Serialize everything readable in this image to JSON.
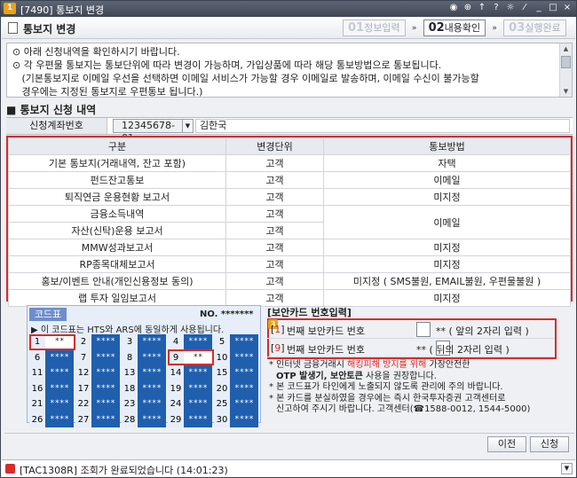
{
  "window": {
    "app_number": "1",
    "title": "[7490] 통보지 변경",
    "controls": [
      "◉",
      "⊕",
      "↑",
      "?",
      "☼",
      "⁄",
      "_",
      "□",
      "×"
    ]
  },
  "header": {
    "page_title": "통보지 변경",
    "steps": [
      {
        "num": "01",
        "label": "정보입력"
      },
      {
        "num": "02",
        "label": "내용확인"
      },
      {
        "num": "03",
        "label": "실행완료"
      }
    ],
    "arrow": "»"
  },
  "notice": {
    "lines": [
      "⊙ 아래 신청내역을 확인하시기 바랍니다.",
      "⊙ 각 우편물 통보지는 통보단위에 따라 변경이 가능하며, 가입상품에 따라 해당 통보방법으로 통보됩니다.",
      "   (기본통보지로 이메일 우선을 선택하면 이메일 서비스가 가능할 경우 이메일로 발송하며, 이메일 수신이 불가능할",
      "   경우에는 지정된 통보지로 우편통보 됩니다.)"
    ]
  },
  "section_title": "■  통보지 신청 내역",
  "account": {
    "label": "신청계좌번호",
    "number": "12345678-01",
    "name": "김한국"
  },
  "table": {
    "headers": [
      "구분",
      "변경단위",
      "통보방법"
    ],
    "rows": [
      [
        "기본 통보지(거래내역, 잔고 포함)",
        "고객",
        "자택"
      ],
      [
        "펀드잔고통보",
        "고객",
        "이메일"
      ],
      [
        "퇴직연금 운용현황 보고서",
        "고객",
        "미지정"
      ],
      [
        "금융소득내역",
        "고객",
        "이메일"
      ],
      [
        "자산(신탁)운용 보고서",
        "고객",
        ""
      ],
      [
        "MMW성과보고서",
        "고객",
        "미지정"
      ],
      [
        "RP종목대체보고서",
        "고객",
        "미지정"
      ],
      [
        "홍보/이벤트 안내(개인신용정보 동의)",
        "고객",
        "미지정 ( SMS불원, EMAIL불원, 우편물불원 )"
      ],
      [
        "랩 투자 일임보고서",
        "고객",
        "미지정"
      ]
    ]
  },
  "code_card": {
    "header": "코드표",
    "number_label": "NO. *******",
    "info": "▶ 이 코드표는 HTS와 ARS에 동일하게 사용됩니다.",
    "cells": [
      [
        "1",
        "**"
      ],
      [
        "2",
        "****"
      ],
      [
        "3",
        "****"
      ],
      [
        "4",
        "****"
      ],
      [
        "5",
        "****"
      ],
      [
        "6",
        "****"
      ],
      [
        "7",
        "****"
      ],
      [
        "8",
        "****"
      ],
      [
        "9",
        "**"
      ],
      [
        "10",
        "****"
      ],
      [
        "11",
        "****"
      ],
      [
        "12",
        "****"
      ],
      [
        "13",
        "****"
      ],
      [
        "14",
        "****"
      ],
      [
        "15",
        "****"
      ],
      [
        "16",
        "****"
      ],
      [
        "17",
        "****"
      ],
      [
        "18",
        "****"
      ],
      [
        "19",
        "****"
      ],
      [
        "20",
        "****"
      ],
      [
        "21",
        "****"
      ],
      [
        "22",
        "****"
      ],
      [
        "23",
        "****"
      ],
      [
        "24",
        "****"
      ],
      [
        "25",
        "****"
      ],
      [
        "26",
        "****"
      ],
      [
        "27",
        "****"
      ],
      [
        "28",
        "****"
      ],
      [
        "29",
        "****"
      ],
      [
        "30",
        "****"
      ]
    ]
  },
  "security": {
    "title": "[보안카드 번호입력]",
    "badge": "3",
    "row1": {
      "num": "1",
      "label": "번째 보안카드 번호",
      "value": "",
      "hint": "** ( 앞의 2자리 입력 )"
    },
    "row2": {
      "num": "9",
      "label": "번째 보안카드 번호",
      "value": "",
      "hint": "** ( 뒤의 2자리 입력 )"
    },
    "notes": {
      "n1a": "* 인터넷 금융거래시 ",
      "n1b": "해킹피해 방지를 위해",
      "n1c": " 가장안전한",
      "n2": "OTP 발생기, 보안토큰",
      "n2b": " 사용을 권장합니다.",
      "n3": "* 본 코드표가 타인에게 노출되지 않도록 관리에 주의 바랍니다.",
      "n4": "* 본 카드를 분실하였을 경우에는 즉시 한국투자증권 고객센터로",
      "n5": "신고하여 주시기 바랍니다. 고객센터(☎1588-0012, 1544-5000)"
    }
  },
  "buttons": {
    "prev": "이전",
    "apply": "신청"
  },
  "status": {
    "message": "[TAC1308R] 조회가 완료되었습니다 (14:01:23)"
  },
  "colors": {
    "highlight": "#d92b2b",
    "code_cell": "#1f5fae",
    "title_bar": "#4a5262"
  }
}
